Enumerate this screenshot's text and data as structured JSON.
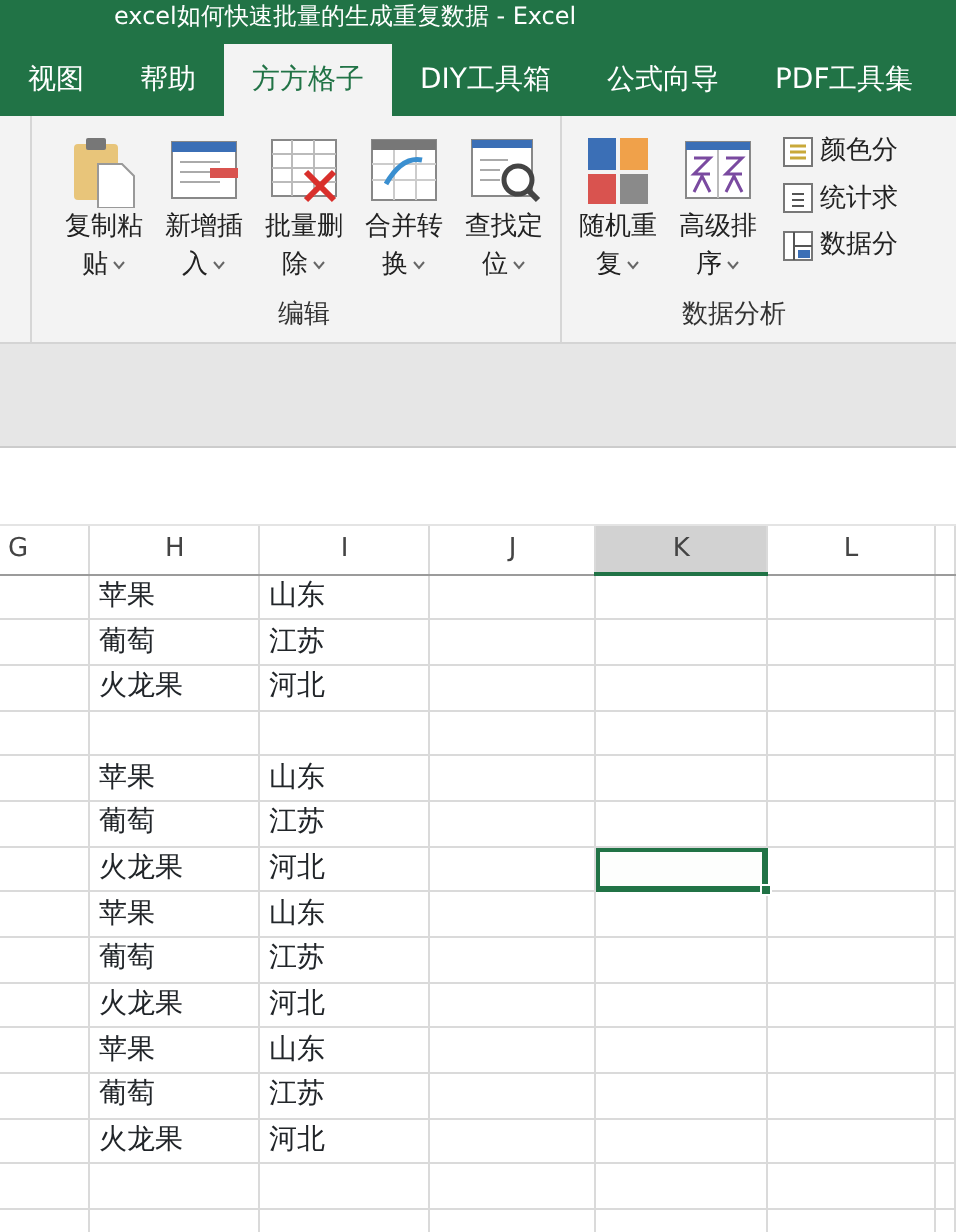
{
  "window": {
    "title": "excel如何快速批量的生成重复数据 - Excel"
  },
  "tabs": [
    {
      "label": "视图",
      "selected": false
    },
    {
      "label": "帮助",
      "selected": false
    },
    {
      "label": "方方格子",
      "selected": true
    },
    {
      "label": "DIY工具箱",
      "selected": false
    },
    {
      "label": "公式向导",
      "selected": false
    },
    {
      "label": "PDF工具集",
      "selected": false
    }
  ],
  "ribbon": {
    "groups": [
      {
        "label": "编辑",
        "buttons": [
          {
            "kind": "paste",
            "label": "复制粘贴"
          },
          {
            "kind": "insert",
            "label": "新增插入"
          },
          {
            "kind": "delete",
            "label": "批量删除"
          },
          {
            "kind": "merge",
            "label": "合并转换"
          },
          {
            "kind": "find",
            "label": "查找定位"
          }
        ]
      },
      {
        "label": "数据分析",
        "buttons": [
          {
            "kind": "tiles",
            "label": "随机重复"
          },
          {
            "kind": "sort",
            "label": "高级排序"
          }
        ],
        "small_buttons": [
          {
            "kind": "color",
            "label": "颜色分"
          },
          {
            "kind": "sum",
            "label": "统计求"
          },
          {
            "kind": "split",
            "label": "数据分"
          }
        ]
      }
    ]
  },
  "sheet": {
    "columns": [
      {
        "label": "G",
        "selected": false
      },
      {
        "label": "H",
        "selected": false
      },
      {
        "label": "I",
        "selected": false
      },
      {
        "label": "J",
        "selected": false
      },
      {
        "label": "K",
        "selected": true
      },
      {
        "label": "L",
        "selected": false
      }
    ],
    "rows": [
      {
        "h": "苹果",
        "i": "山东",
        "k_selected": false
      },
      {
        "h": "葡萄",
        "i": "江苏",
        "k_selected": false
      },
      {
        "h": "火龙果",
        "i": "河北",
        "k_selected": false
      },
      {
        "k_selected": false
      },
      {
        "h": "苹果",
        "i": "山东",
        "k_selected": false
      },
      {
        "h": "葡萄",
        "i": "江苏",
        "k_selected": false
      },
      {
        "h": "火龙果",
        "i": "河北",
        "k_selected": true
      },
      {
        "h": "苹果",
        "i": "山东",
        "k_selected": false
      },
      {
        "h": "葡萄",
        "i": "江苏",
        "k_selected": false
      },
      {
        "h": "火龙果",
        "i": "河北",
        "k_selected": false
      },
      {
        "h": "苹果",
        "i": "山东",
        "k_selected": false
      },
      {
        "h": "葡萄",
        "i": "江苏",
        "k_selected": false
      },
      {
        "h": "火龙果",
        "i": "河北",
        "k_selected": false
      },
      {
        "k_selected": false
      },
      {
        "k_selected": false
      }
    ]
  }
}
